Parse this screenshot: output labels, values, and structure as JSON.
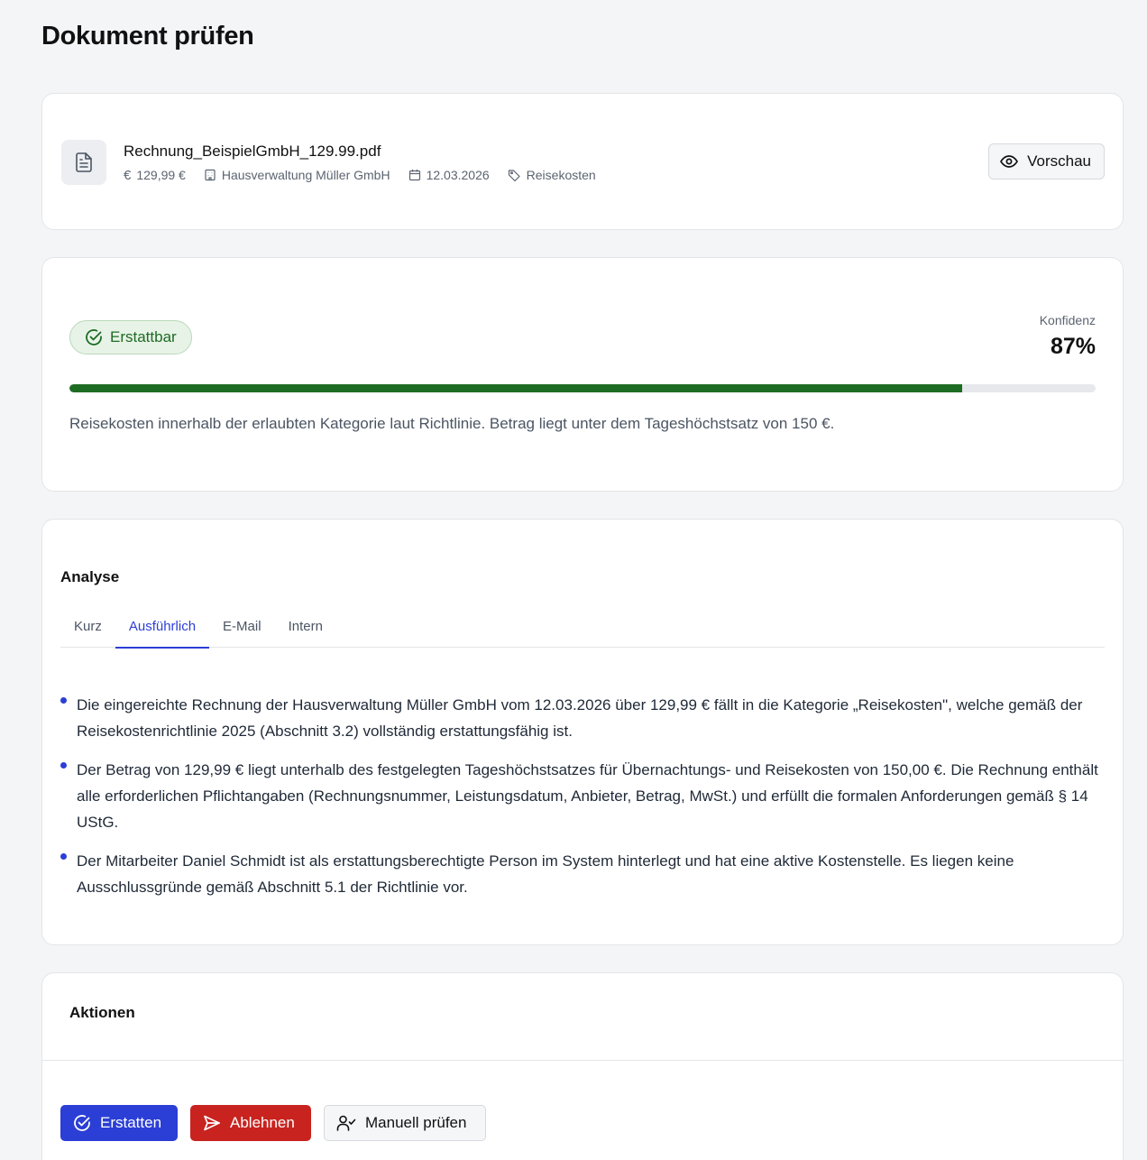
{
  "page": {
    "title": "Dokument prüfen"
  },
  "document": {
    "filename": "Rechnung_BeispielGmbH_129.99.pdf",
    "amount": "129,99 €",
    "vendor": "Hausverwaltung Müller GmbH",
    "date": "12.03.2026",
    "category": "Reisekosten",
    "icons": [
      "file-text-icon",
      "euro-icon",
      "building-icon",
      "calendar-icon",
      "tag-icon"
    ],
    "preview_label": "Vorschau",
    "preview_icon": "eye-icon"
  },
  "decision": {
    "status_label": "Erstattbar",
    "status_icon": "check-circle-icon",
    "status_color": "#1e6b23",
    "confidence_label": "Konfidenz",
    "confidence_value": "87%",
    "confidence_fraction": 0.87,
    "reason": "Reisekosten innerhalb der erlaubten Kategorie laut Richtlinie. Betrag liegt unter dem Tageshöchstsatz von 150 €."
  },
  "analysis": {
    "title": "Analyse",
    "tabs": [
      {
        "label": "Kurz",
        "active": false
      },
      {
        "label": "Ausführlich",
        "active": true
      },
      {
        "label": "E-Mail",
        "active": false
      },
      {
        "label": "Intern",
        "active": false
      }
    ],
    "bullets": [
      "Die eingereichte Rechnung der Hausverwaltung Müller GmbH vom 12.03.2026 über 129,99 € fällt in die Kategorie „Reisekosten\", welche gemäß der Reisekostenrichtlinie 2025 (Abschnitt 3.2) vollständig erstattungsfähig ist.",
      "Der Betrag von 129,99 € liegt unterhalb des festgelegten Tageshöchstsatzes für Übernachtungs- und Reisekosten von 150,00 €. Die Rechnung enthält alle erforderlichen Pflichtangaben (Rechnungsnummer, Leistungsdatum, Anbieter, Betrag, MwSt.) und erfüllt die formalen Anforderungen gemäß § 14 UStG.",
      "Der Mitarbeiter Daniel Schmidt ist als erstattungsberechtigte Person im System hinterlegt und hat eine aktive Kostenstelle. Es liegen keine Ausschlussgründe gemäß Abschnitt 5.1 der Richtlinie vor."
    ]
  },
  "actions": {
    "title": "Aktionen",
    "refund_label": "Erstatten",
    "refund_icon": "check-circle-icon",
    "reject_label": "Ablehnen",
    "reject_icon": "send-icon",
    "manual_label": "Manuell prüfen",
    "manual_icon": "user-check-icon",
    "colors": {
      "primary": "#2b3ed6",
      "danger": "#c8231f"
    }
  }
}
